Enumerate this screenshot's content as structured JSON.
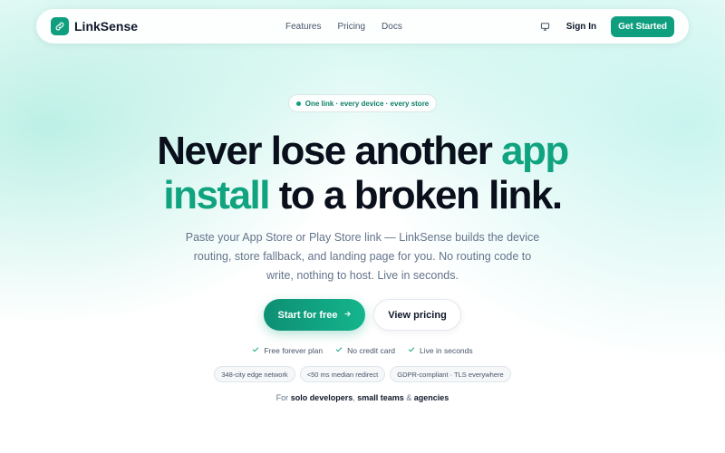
{
  "nav": {
    "brand": "LinkSense",
    "links": [
      "Features",
      "Pricing",
      "Docs"
    ],
    "sign_in": "Sign In",
    "get_started": "Get Started"
  },
  "hero": {
    "pill": "One link · every device · every store",
    "headline_1": "Never lose another ",
    "headline_accent_1": "app",
    "headline_accent_2": "install",
    "headline_2": " to a broken link.",
    "subtitle": "Paste your App Store or Play Store link — LinkSense builds the device routing, store fallback, and landing page for you. No routing code to write, nothing to host. Live in seconds.",
    "cta_primary": "Start for free",
    "cta_secondary": "View pricing",
    "checks": [
      "Free forever plan",
      "No credit card",
      "Live in seconds"
    ],
    "badges": [
      "348-city edge network",
      "<50 ms median redirect",
      "GDPR-compliant · TLS everywhere"
    ],
    "for_prefix": "For ",
    "for_a": "solo developers",
    "for_sep1": ", ",
    "for_b": "small teams",
    "for_sep2": " & ",
    "for_c": "agencies"
  },
  "colors": {
    "accent": "#10a37f",
    "brand": "#0f9f7f"
  },
  "icons": [
    "link-icon",
    "monitor-icon",
    "arrow-right-icon",
    "check-icon"
  ]
}
